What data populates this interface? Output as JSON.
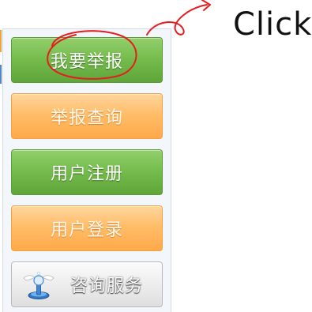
{
  "menu": {
    "items": [
      {
        "label": "我要举报",
        "style": "green"
      },
      {
        "label": "举报查询",
        "style": "orange"
      },
      {
        "label": "用户注册",
        "style": "green"
      },
      {
        "label": "用户登录",
        "style": "orange"
      },
      {
        "label": "咨询服务",
        "style": "gray",
        "icon": "consultation-service-icon"
      }
    ]
  },
  "annotation": {
    "text": "Click",
    "ink_color": "#e41e1e",
    "text_color": "#111111"
  },
  "colors": {
    "green_button": "#76bd4e",
    "orange_button": "#ffbd69",
    "gray_button": "#ececec",
    "panel_background": "#f3f6fb"
  }
}
